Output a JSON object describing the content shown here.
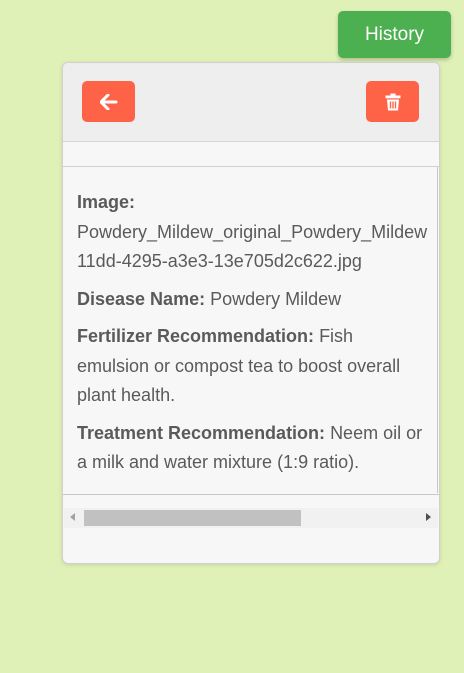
{
  "header": {
    "history_label": "History"
  },
  "record": {
    "image_label": "Image:",
    "image_line1": "Powdery_Mildew_original_Powdery_Mildew",
    "image_line2": "11dd-4295-a3e3-13e705d2c622.jpg",
    "disease_label": "Disease Name:",
    "disease_value": "Powdery Mildew",
    "fertilizer_label": "Fertilizer Recommendation:",
    "fertilizer_value": "Fish emulsion or compost tea to boost overall plant health.",
    "treatment_label": "Treatment Recommendation:",
    "treatment_value": "Neem oil or a milk and water mixture (1:9 ratio)."
  },
  "icons": {
    "back": "arrow-left-icon",
    "delete": "trash-icon"
  },
  "scrollbar": {
    "horizontal_position": 0.0,
    "visible_fraction": 0.65
  },
  "colors": {
    "background": "#e0f1b8",
    "history_button": "#4caf50",
    "action_button": "#fe6347",
    "card": "#f7f7f7",
    "card_header": "#eeeeee",
    "text": "#5a5a5a"
  }
}
